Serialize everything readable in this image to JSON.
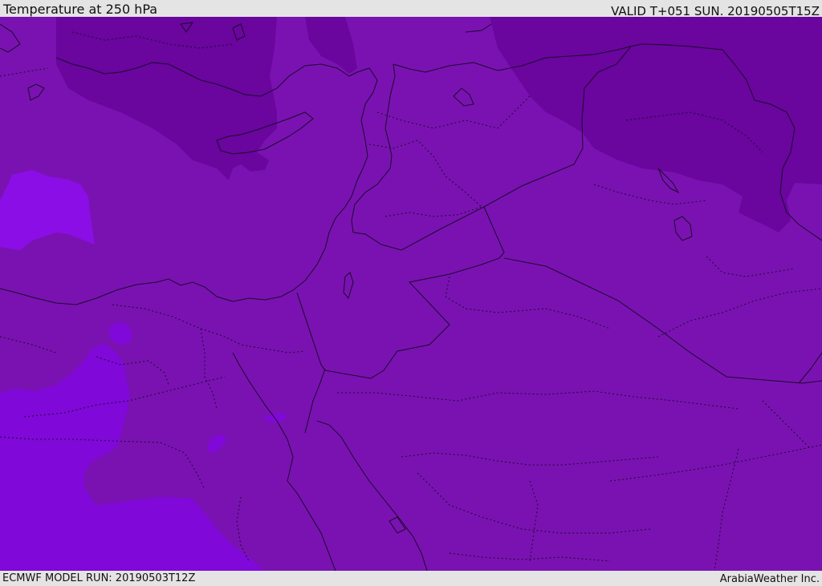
{
  "header": {
    "title": "Temperature at 250 hPa",
    "valid": "VALID T+051 SUN. 20190505T15Z"
  },
  "footer": {
    "model_run": "ECMWF MODEL RUN: 20190503T12Z",
    "credit": "ArabiaWeather Inc."
  },
  "map": {
    "field": "temperature-250hpa",
    "colors": {
      "base": "#7a12b2",
      "cold": "#6a059e",
      "warm": "#8b0ee6",
      "warm_mid": "#8008d9",
      "borders": "#1a0a2a"
    }
  }
}
